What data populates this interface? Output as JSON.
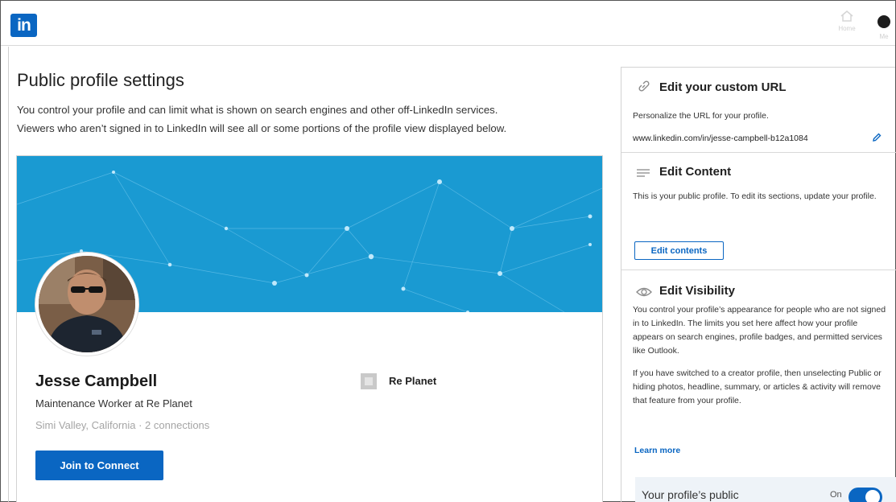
{
  "topbar": {
    "logo": "in",
    "nav_home_label": "Home",
    "nav_me_label": "Me"
  },
  "page": {
    "title": "Public profile settings",
    "description_line1": "You control your profile and can limit what is shown on search engines and other off-LinkedIn services.",
    "description_line2": "Viewers who aren’t signed in to LinkedIn will see all or some portions of the profile view displayed below."
  },
  "profile": {
    "name": "Jesse Campbell",
    "headline": "Maintenance Worker at Re Planet",
    "location": "Simi Valley, California · 2 connections",
    "company": "Re Planet",
    "join_button": "Join to Connect"
  },
  "sidebar": {
    "custom_url": {
      "heading": "Edit your custom URL",
      "text": "Personalize the URL for your profile.",
      "url": "www.linkedin.com/in/jesse-campbell-b12a1084"
    },
    "content": {
      "heading": "Edit Content",
      "text": "This is your public profile. To edit its sections, update your profile.",
      "button": "Edit contents"
    },
    "visibility": {
      "heading": "Edit Visibility",
      "text1": "You control your profile’s appearance for people who are not signed in to LinkedIn. The limits you set here affect how your profile appears on search engines, profile badges, and permitted services like Outlook.",
      "text2": "If you have switched to a creator profile, then unselecting Public or hiding photos, headline, summary, or articles & activity will remove that feature from your profile.",
      "learn_more": "Learn more",
      "public_label": "Your profile’s public",
      "toggle_state": "On"
    }
  },
  "colors": {
    "brand": "#0a66c2",
    "banner": "#1a9ad2"
  }
}
